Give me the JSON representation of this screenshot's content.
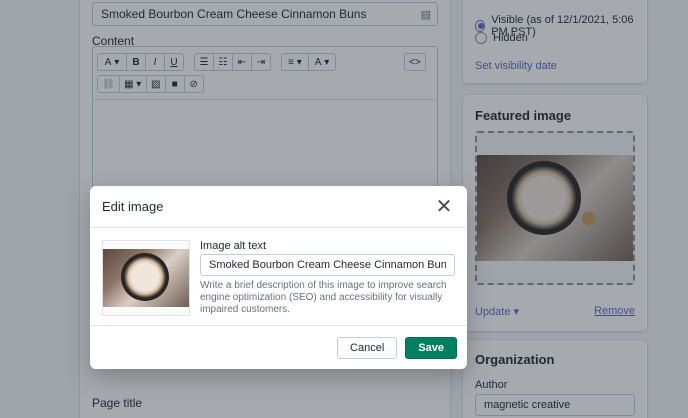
{
  "background": {
    "title_input_value": "Smoked Bourbon Cream Cheese Cinnamon Buns",
    "content_label": "Content",
    "page_title_label": "Page title",
    "toolbar": {
      "font_label": "A",
      "bold_label": "B",
      "italic_label": "I",
      "underline_label": "U",
      "align_label": "≡",
      "color_label": "A",
      "code_label": "<>"
    },
    "visibility": {
      "visible_label": "Visible (as of 12/1/2021, 5:06 PM PST)",
      "hidden_label": "Hidden",
      "set_date_link": "Set visibility date"
    },
    "featured_image": {
      "heading": "Featured image",
      "update_link": "Update ▾",
      "remove_link": "Remove"
    },
    "organization": {
      "heading": "Organization",
      "author_label": "Author",
      "author_value": "magnetic creative"
    }
  },
  "modal": {
    "title": "Edit image",
    "close_glyph": "✕",
    "alt_label": "Image alt text",
    "alt_value": "Smoked Bourbon Cream Cheese Cinnamon Buns",
    "help_text": "Write a brief description of this image to improve search engine optimization (SEO) and accessibility for visually impaired customers.",
    "cancel_label": "Cancel",
    "save_label": "Save"
  },
  "colors": {
    "primary_green": "#008060",
    "link_indigo": "#5c6ac4"
  }
}
